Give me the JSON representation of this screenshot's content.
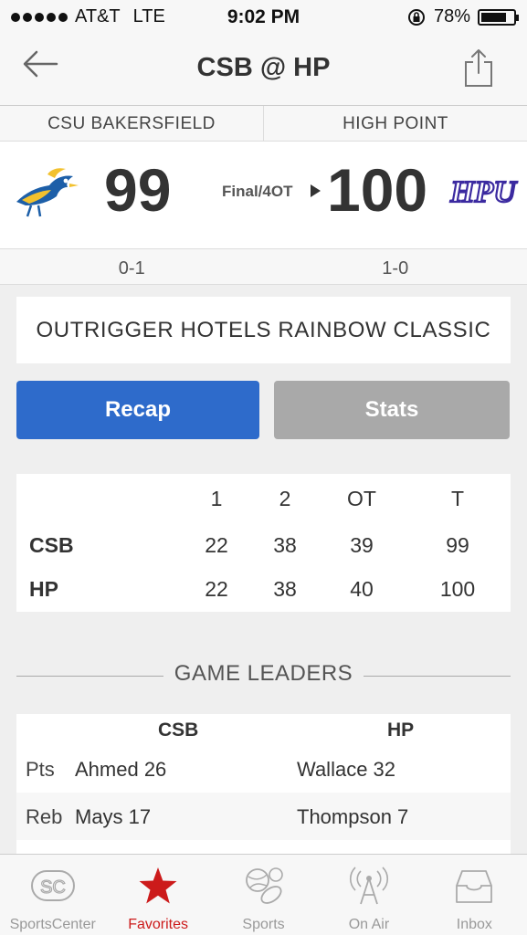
{
  "status_bar": {
    "carrier": "AT&T",
    "network": "LTE",
    "time": "9:02 PM",
    "battery": "78%",
    "battery_level": 0.78
  },
  "nav": {
    "title": "CSB @ HP",
    "back_icon": "back-arrow-icon",
    "share_icon": "share-icon"
  },
  "teams": {
    "away_name": "CSU BAKERSFIELD",
    "home_name": "HIGH POINT",
    "away_score": "99",
    "home_score": "100",
    "status": "Final/4OT",
    "away_record": "0-1",
    "home_record": "1-0",
    "home_logo_text": "HPU"
  },
  "event": {
    "name": "OUTRIGGER HOTELS RAINBOW CLASSIC"
  },
  "buttons": {
    "recap": "Recap",
    "stats": "Stats",
    "recap_color": "#2e6bcb",
    "stats_color": "#a9a9a9"
  },
  "linescore": {
    "headers": [
      "1",
      "2",
      "OT",
      "T"
    ],
    "rows": [
      {
        "team": "CSB",
        "values": [
          "22",
          "38",
          "39",
          "99"
        ]
      },
      {
        "team": "HP",
        "values": [
          "22",
          "38",
          "40",
          "100"
        ]
      }
    ]
  },
  "leaders": {
    "heading": "GAME LEADERS",
    "away_team": "CSB",
    "home_team": "HP",
    "rows": [
      {
        "stat": "Pts",
        "away": "Ahmed 26",
        "home": "Wallace 32"
      },
      {
        "stat": "Reb",
        "away": "Mays 17",
        "home": "Thompson 7"
      }
    ]
  },
  "tabs": [
    {
      "label": "SportsCenter",
      "icon": "sportscenter-icon",
      "active": false
    },
    {
      "label": "Favorites",
      "icon": "star-icon",
      "active": true
    },
    {
      "label": "Sports",
      "icon": "sports-balls-icon",
      "active": false
    },
    {
      "label": "On Air",
      "icon": "antenna-icon",
      "active": false
    },
    {
      "label": "Inbox",
      "icon": "inbox-icon",
      "active": false
    }
  ],
  "colors": {
    "accent_red": "#cc1b1b",
    "csb_blue": "#1d5fa8",
    "csb_gold": "#f2c12e",
    "hpu_purple": "#3b2aa0"
  }
}
